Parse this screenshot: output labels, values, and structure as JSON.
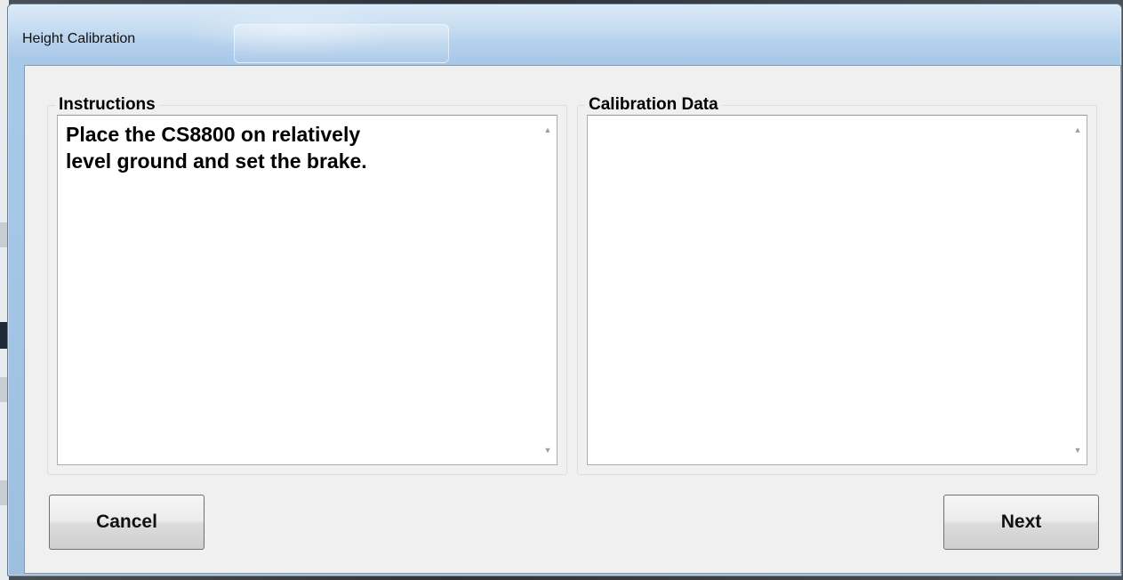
{
  "window": {
    "title": "Height Calibration"
  },
  "instructions": {
    "label": "Instructions",
    "text": "Place the CS8800 on relatively\nlevel ground and set the brake."
  },
  "calibration": {
    "label": "Calibration Data",
    "text": ""
  },
  "buttons": {
    "cancel_label": "Cancel",
    "next_label": "Next"
  },
  "icons": {
    "scroll_up": "scroll-up-arrow-icon",
    "scroll_down": "scroll-down-arrow-icon"
  }
}
